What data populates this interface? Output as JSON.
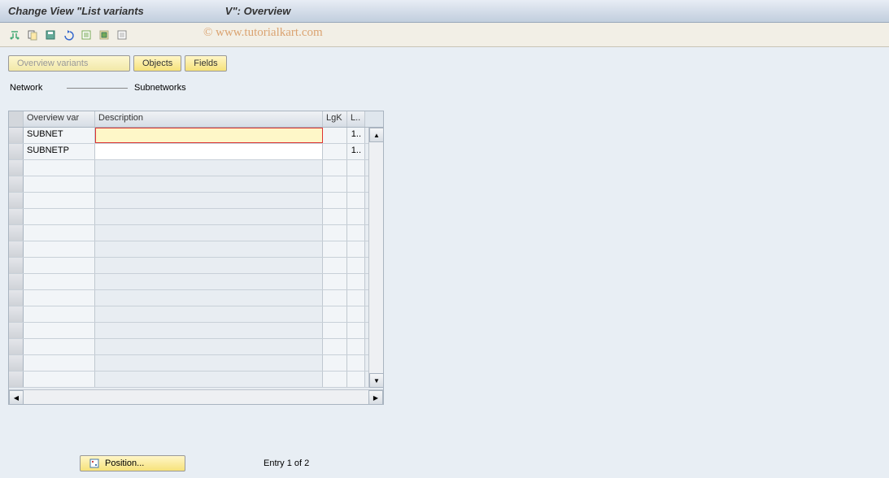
{
  "title": {
    "part1": "Change View \"List variants",
    "part2": "V\": Overview"
  },
  "watermark": "© www.tutorialkart.com",
  "toolbar_icons": [
    "other-view-icon",
    "copy-icon",
    "save-icon",
    "undo-icon",
    "new-entries-icon",
    "select-block-icon",
    "deselect-icon"
  ],
  "tabs": {
    "overview": "Overview variants",
    "objects": "Objects",
    "fields": "Fields"
  },
  "network": {
    "label": "Network",
    "value": "Subnetworks"
  },
  "grid": {
    "headers": {
      "overview": "Overview var",
      "description": "Description",
      "lgk": "LgK",
      "l": "L.."
    },
    "rows": [
      {
        "ov": "SUBNET",
        "desc": "",
        "lgk": "",
        "l": "1.."
      },
      {
        "ov": "SUBNETP",
        "desc": "",
        "lgk": "",
        "l": "1.."
      }
    ],
    "empty_row_count": 14
  },
  "position": {
    "label": "Position...",
    "entry": "Entry 1 of 2"
  }
}
